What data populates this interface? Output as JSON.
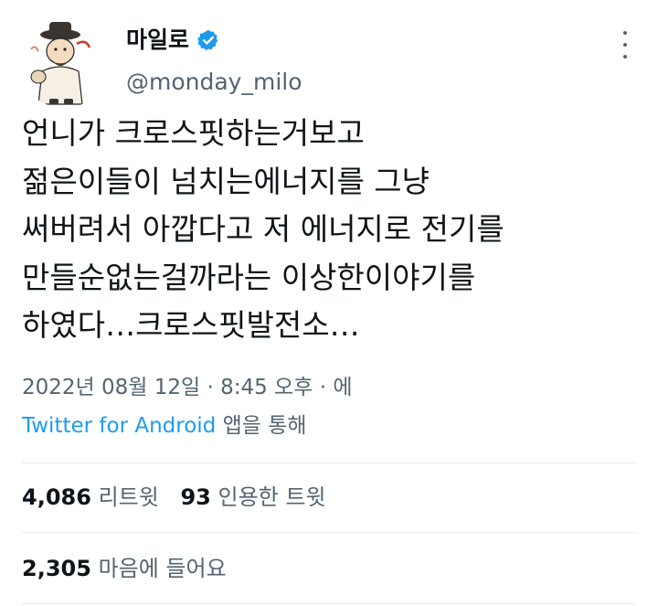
{
  "user": {
    "display_name": "마일로",
    "handle": "@monday_milo",
    "verified": true
  },
  "tweet": {
    "lines": [
      "언니가 크로스핏하는거보고",
      "젊은이들이 넘치는에너지를 그냥",
      "써버려서 아깝다고 저 에너지로 전기를",
      "만들순없는걸까라는 이상한이야기를",
      "하였다…크로스핏발전소…"
    ]
  },
  "meta": {
    "timestamp": "2022년 08월 12일 · 8:45 오후 · 에",
    "source_app": "Twitter for Android",
    "source_suffix": " 앱을 통해"
  },
  "stats": {
    "retweets_count": "4,086",
    "retweets_label": "리트윗",
    "quotes_count": "93",
    "quotes_label": "인용한 트윗",
    "likes_count": "2,305",
    "likes_label": "마음에 들어요"
  },
  "colors": {
    "text": "#0f1419",
    "secondary": "#536471",
    "link": "#1d9bf0",
    "divider": "#e6ecf0"
  },
  "icons": {
    "verified": "verified-badge-icon",
    "more": "more-options-icon"
  }
}
